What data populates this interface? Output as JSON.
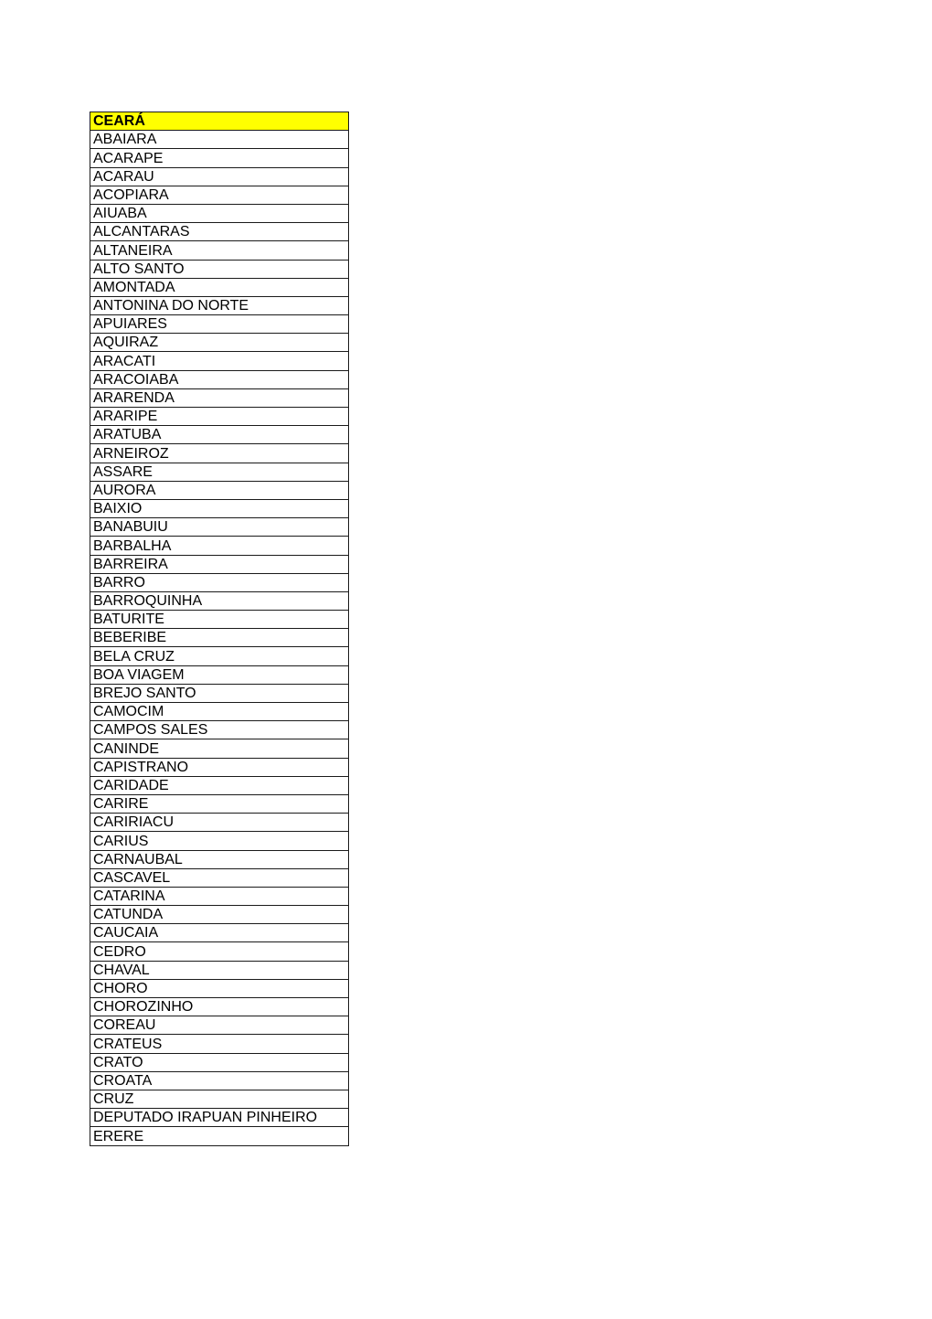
{
  "sheet": {
    "header": "CEARÁ",
    "header_color": "#ffff00",
    "rows": [
      "ABAIARA",
      "ACARAPE",
      "ACARAU",
      "ACOPIARA",
      "AIUABA",
      "ALCANTARAS",
      "ALTANEIRA",
      "ALTO SANTO",
      "AMONTADA",
      "ANTONINA DO NORTE",
      "APUIARES",
      "AQUIRAZ",
      "ARACATI",
      "ARACOIABA",
      "ARARENDA",
      "ARARIPE",
      "ARATUBA",
      "ARNEIROZ",
      "ASSARE",
      "AURORA",
      "BAIXIO",
      "BANABUIU",
      "BARBALHA",
      "BARREIRA",
      "BARRO",
      "BARROQUINHA",
      "BATURITE",
      "BEBERIBE",
      "BELA CRUZ",
      "BOA VIAGEM",
      "BREJO SANTO",
      "CAMOCIM",
      "CAMPOS SALES",
      "CANINDE",
      "CAPISTRANO",
      "CARIDADE",
      "CARIRE",
      "CARIRIACU",
      "CARIUS",
      "CARNAUBAL",
      "CASCAVEL",
      "CATARINA",
      "CATUNDA",
      "CAUCAIA",
      "CEDRO",
      "CHAVAL",
      "CHORO",
      "CHOROZINHO",
      "COREAU",
      "CRATEUS",
      "CRATO",
      "CROATA",
      "CRUZ",
      "DEPUTADO IRAPUAN PINHEIRO",
      "ERERE"
    ]
  }
}
